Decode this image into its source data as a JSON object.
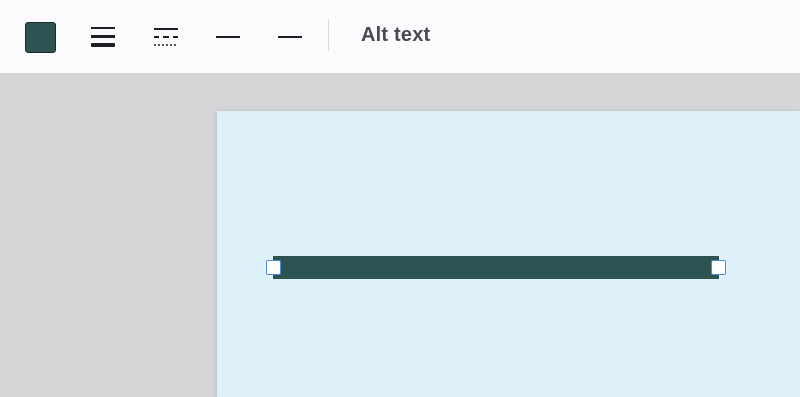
{
  "toolbar": {
    "line_color": "#2d5452",
    "alt_text_label": "Alt text",
    "icons": [
      "color-swatch",
      "line-weight-icon",
      "line-dash-icon",
      "line-start-icon",
      "line-end-icon"
    ]
  },
  "slide": {
    "background": "#def0fa",
    "selected_shape": {
      "type": "line",
      "color": "#2d5452"
    }
  }
}
